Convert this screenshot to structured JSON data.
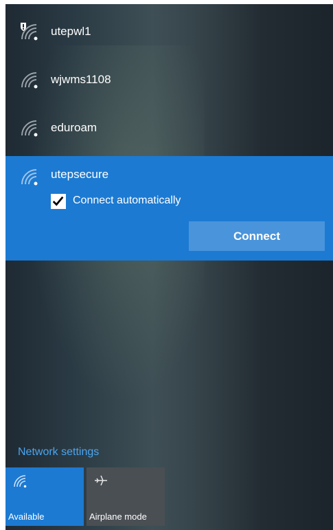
{
  "networks": [
    {
      "name": "utepwl1",
      "secured": false,
      "shield": true
    },
    {
      "name": "wjwms1108",
      "secured": false,
      "shield": false
    },
    {
      "name": "eduroam",
      "secured": false,
      "shield": false
    }
  ],
  "selected_network": {
    "name": "utepsecure",
    "connect_automatically_label": "Connect automatically",
    "connect_automatically_checked": true,
    "connect_button_label": "Connect"
  },
  "footer": {
    "network_settings_label": "Network settings",
    "tiles": [
      {
        "label": "Available",
        "icon": "wifi-icon",
        "active": true
      },
      {
        "label": "Airplane mode",
        "icon": "airplane-icon",
        "active": false
      }
    ]
  },
  "colors": {
    "accent": "#1c7ad2",
    "button": "#4a94db",
    "link": "#4aa6f0",
    "tile_inactive": "#4a4f54"
  }
}
